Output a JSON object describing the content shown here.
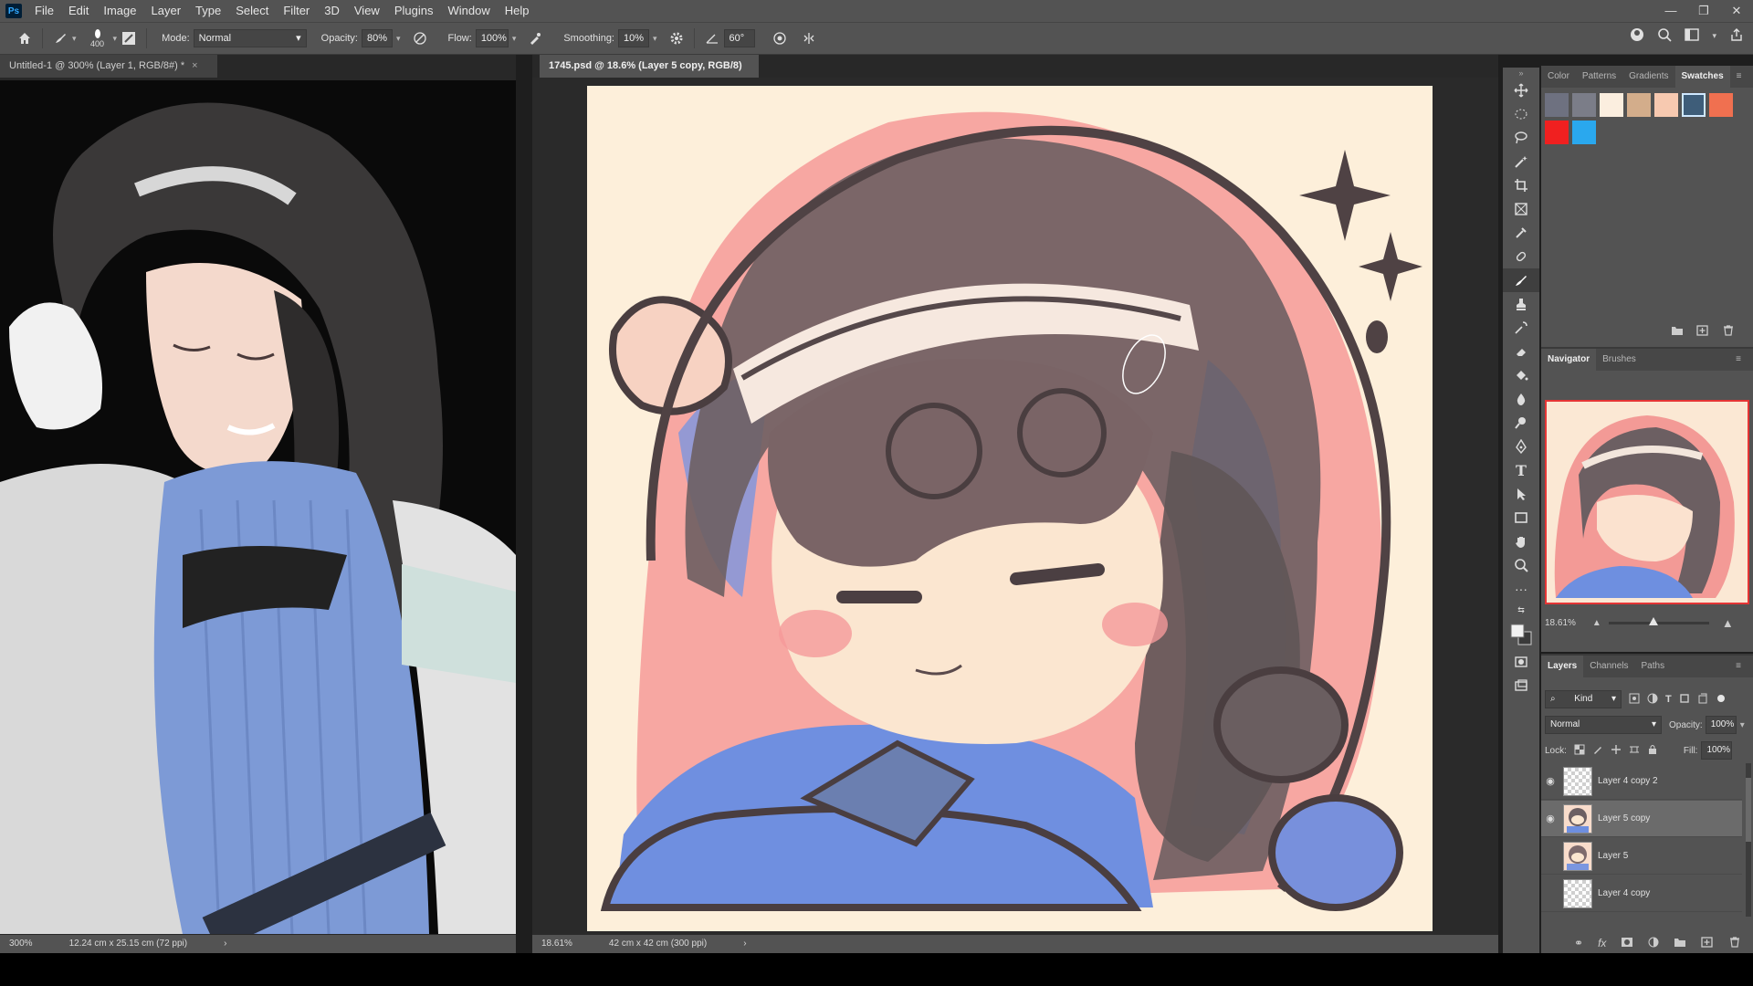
{
  "app": {
    "logo": "Ps"
  },
  "menu": [
    "File",
    "Edit",
    "Image",
    "Layer",
    "Type",
    "Select",
    "Filter",
    "3D",
    "View",
    "Plugins",
    "Window",
    "Help"
  ],
  "window_controls": {
    "minimize": "—",
    "restore": "❐",
    "close": "✕"
  },
  "options": {
    "brush_size": "400",
    "mode_label": "Mode:",
    "mode_value": "Normal",
    "opacity_label": "Opacity:",
    "opacity_value": "80%",
    "flow_label": "Flow:",
    "flow_value": "100%",
    "smoothing_label": "Smoothing:",
    "smoothing_value": "10%",
    "angle_value": "60°"
  },
  "docs": [
    {
      "title": "Untitled-1 @ 300% (Layer 1, RGB/8#) *",
      "zoom": "300%",
      "info": "12.24 cm x 25.15 cm (72 ppi)"
    },
    {
      "title": "1745.psd @ 18.6% (Layer 5 copy, RGB/8) *",
      "zoom": "18.61%",
      "info": "42 cm x 42 cm (300 ppi)"
    }
  ],
  "tab_close": "×",
  "swatches_panel": {
    "tabs": [
      "Color",
      "Patterns",
      "Gradients",
      "Swatches"
    ],
    "active": "Swatches",
    "colors": [
      "#6e7180",
      "#7b7d88",
      "#fbeedf",
      "#d3ad8b",
      "#f7c9b0",
      "#3e5d79",
      "#f07050",
      "#f02020",
      "#2aa8ee"
    ]
  },
  "navigator_panel": {
    "tabs": [
      "Navigator",
      "Brushes"
    ],
    "active": "Navigator",
    "zoom": "18.61%",
    "zoom_slider": 0.45
  },
  "layers_panel": {
    "tabs": [
      "Layers",
      "Channels",
      "Paths"
    ],
    "active": "Layers",
    "filter": "Kind",
    "blend_mode": "Normal",
    "opacity_label": "Opacity:",
    "opacity_value": "100%",
    "lock_label": "Lock:",
    "fill_label": "Fill:",
    "fill_value": "100%",
    "layers": [
      {
        "name": "Layer 4 copy 2",
        "visible": true,
        "selected": false
      },
      {
        "name": "Layer 5 copy",
        "visible": true,
        "selected": true
      },
      {
        "name": "Layer 5",
        "visible": false,
        "selected": false
      },
      {
        "name": "Layer 4 copy",
        "visible": false,
        "selected": false
      }
    ]
  },
  "icons": {
    "home": "⌂",
    "brush": "🖌",
    "eye": "👁",
    "gear": "⚙",
    "search": "⌕",
    "share": "⇪",
    "fx": "fx"
  }
}
